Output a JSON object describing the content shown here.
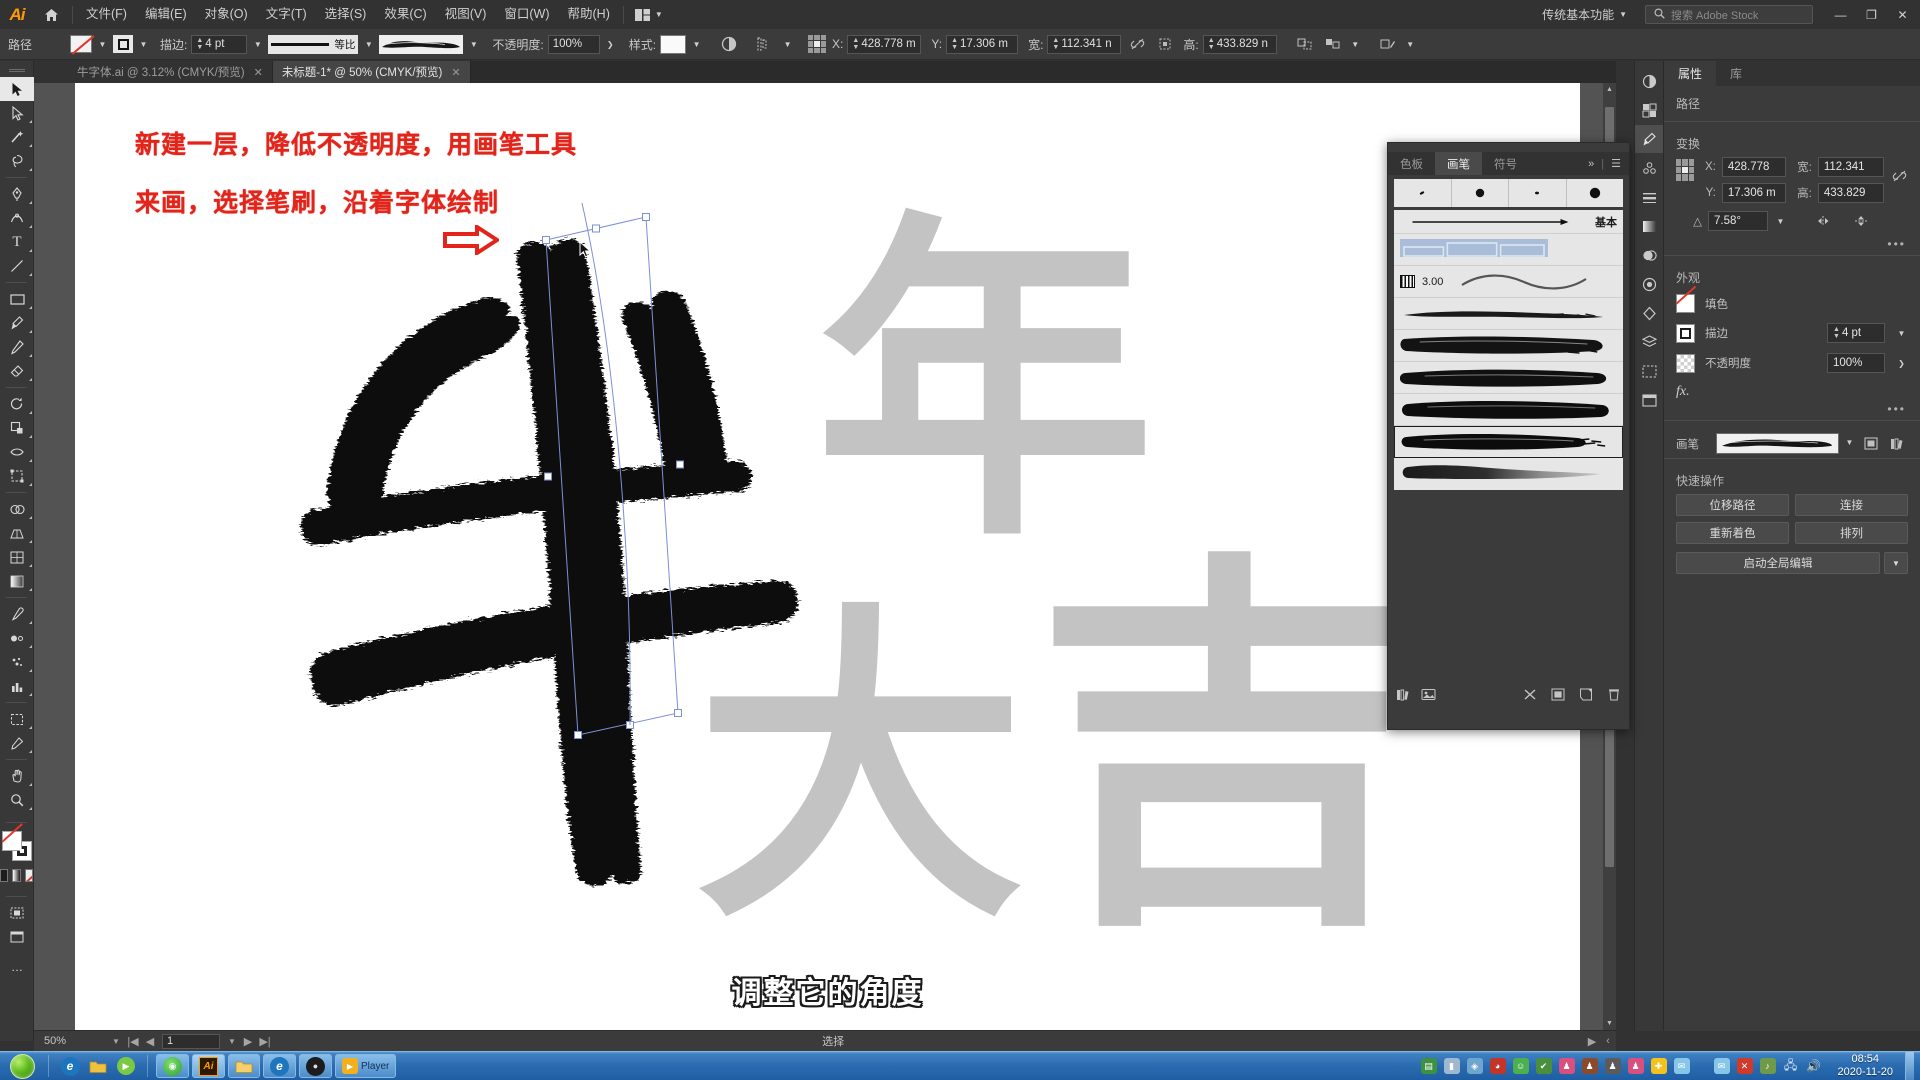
{
  "app": {
    "logo": "Ai",
    "home_icon": "home-icon",
    "workspace": "传统基本功能",
    "search_placeholder": "搜索 Adobe Stock",
    "search_icon": "search-icon",
    "window_controls": {
      "minimize": "—",
      "maximize": "❐",
      "close": "✕"
    }
  },
  "menu": {
    "items": [
      {
        "label": "文件(F)"
      },
      {
        "label": "编辑(E)"
      },
      {
        "label": "对象(O)"
      },
      {
        "label": "文字(T)"
      },
      {
        "label": "选择(S)"
      },
      {
        "label": "效果(C)"
      },
      {
        "label": "视图(V)"
      },
      {
        "label": "窗口(W)"
      },
      {
        "label": "帮助(H)"
      }
    ],
    "arrange_icon": "arrange-documents-icon"
  },
  "control_bar": {
    "object_label": "路径",
    "fill_swatch": "none-fill-swatch",
    "stroke_swatch": "black-stroke-swatch",
    "stroke_label": "描边:",
    "stroke_weight": "4 pt",
    "stroke_profile": "等比",
    "brush_definition": "brush-stroke-preview",
    "opacity_label": "不透明度:",
    "opacity_value": "100%",
    "style_label": "样式:",
    "style_swatch": "white-style-swatch",
    "isolate_icon": "isolate-icon",
    "align_icon": "align-icon",
    "transform_reference_icon": "reference-point-icon",
    "x_label": "X:",
    "x_value": "428.778 m",
    "y_label": "Y:",
    "y_value": "17.306 m",
    "w_label": "宽:",
    "w_value": "112.341 n",
    "h_label": "高:",
    "h_value": "433.829 n",
    "lock_ratio_icon": "unlinked-chain-icon",
    "flip_icon": "flip-icon",
    "transform_more_icon": "transform-icon",
    "select_similar_icon": "select-similar-icon",
    "recolor_icon": "recolor-artwork-icon"
  },
  "tabs": [
    {
      "title": "牛字体.ai @ 3.12% (CMYK/预览)",
      "active": false,
      "close_icon": "close-icon"
    },
    {
      "title": "未标题-1* @ 50% (CMYK/预览)",
      "active": true,
      "close_icon": "close-icon"
    }
  ],
  "toolbar": {
    "tools": [
      {
        "name": "selection-tool",
        "glyph": "➤",
        "active": true
      },
      {
        "name": "direct-selection-tool",
        "glyph": "➣",
        "active": false
      },
      {
        "name": "magic-wand-tool",
        "glyph": "✧",
        "active": false
      },
      {
        "name": "lasso-tool",
        "glyph": "◠",
        "active": false
      },
      {
        "name": "pen-tool",
        "glyph": "✒",
        "active": false
      },
      {
        "name": "curvature-tool",
        "glyph": "⌒",
        "active": false
      },
      {
        "name": "type-tool",
        "glyph": "T",
        "active": false
      },
      {
        "name": "line-segment-tool",
        "glyph": "╱",
        "active": false
      },
      {
        "name": "rectangle-tool",
        "glyph": "▭",
        "active": false
      },
      {
        "name": "paintbrush-tool",
        "glyph": "🖌",
        "active": false
      },
      {
        "name": "shaper-tool",
        "glyph": "✎",
        "active": false
      },
      {
        "name": "eraser-tool",
        "glyph": "◧",
        "active": false
      },
      {
        "name": "rotate-tool",
        "glyph": "↻",
        "active": false
      },
      {
        "name": "scale-tool",
        "glyph": "⤢",
        "active": false
      },
      {
        "name": "width-tool",
        "glyph": "⌁",
        "active": false
      },
      {
        "name": "free-transform-tool",
        "glyph": "⬚",
        "active": false
      },
      {
        "name": "shape-builder-tool",
        "glyph": "◉",
        "active": false
      },
      {
        "name": "perspective-grid-tool",
        "glyph": "⧉",
        "active": false
      },
      {
        "name": "mesh-tool",
        "glyph": "▦",
        "active": false
      },
      {
        "name": "gradient-tool",
        "glyph": "▥",
        "active": false
      },
      {
        "name": "eyedropper-tool",
        "glyph": "⚲",
        "active": false
      },
      {
        "name": "blend-tool",
        "glyph": "⬗",
        "active": false
      },
      {
        "name": "symbol-sprayer-tool",
        "glyph": "❀",
        "active": false
      },
      {
        "name": "column-graph-tool",
        "glyph": "📊",
        "active": false
      },
      {
        "name": "artboard-tool",
        "glyph": "⊞",
        "active": false
      },
      {
        "name": "slice-tool",
        "glyph": "✂",
        "active": false
      },
      {
        "name": "hand-tool",
        "glyph": "✋",
        "active": false
      },
      {
        "name": "zoom-tool",
        "glyph": "🔍",
        "active": false
      }
    ],
    "fill_stroke": {
      "fill": "none-fill",
      "stroke": "black-stroke"
    },
    "color_modes": [
      "color-mode",
      "gradient-mode",
      "none-mode"
    ],
    "more_tools": "…"
  },
  "canvas": {
    "background_characters": [
      "年",
      "大",
      "吉"
    ],
    "annotations": [
      {
        "text": "新建一层，降低不透明度，用画笔工具",
        "color": "#e1251b"
      },
      {
        "text": "来画，选择笔刷，沿着字体绘制",
        "color": "#e1251b"
      }
    ],
    "arrow_icon": "right-arrow-icon",
    "subtitle": "调整它的角度"
  },
  "status_bar": {
    "zoom": "50%",
    "page_number": "1",
    "tool_status": "选择",
    "first_icon": "first-page-icon",
    "prev_icon": "prev-page-icon",
    "next_icon": "next-page-icon",
    "last_icon": "last-page-icon"
  },
  "dock_rail": {
    "buttons": [
      {
        "name": "color-panel-icon",
        "glyph": "◑"
      },
      {
        "name": "swatches-panel-icon",
        "glyph": "▤"
      },
      {
        "name": "brushes-panel-icon",
        "glyph": "❙",
        "active": true
      },
      {
        "name": "symbols-panel-icon",
        "glyph": "✿"
      },
      {
        "name": "stroke-panel-icon",
        "glyph": "☰"
      },
      {
        "name": "gradient-panel-icon",
        "glyph": "▨"
      },
      {
        "name": "transparency-panel-icon",
        "glyph": "◍"
      },
      {
        "name": "appearance-panel-icon",
        "glyph": "◎"
      },
      {
        "name": "graphic-styles-panel-icon",
        "glyph": "◈"
      },
      {
        "name": "layers-panel-icon",
        "glyph": "❏"
      },
      {
        "name": "artboards-panel-icon",
        "glyph": "⊡"
      },
      {
        "name": "libraries-panel-icon",
        "glyph": "▣"
      }
    ]
  },
  "properties": {
    "tabs": [
      {
        "label": "属性",
        "active": true
      },
      {
        "label": "库",
        "active": false
      }
    ],
    "object_type": "路径",
    "transform": {
      "title": "变换",
      "reference_point_icon": "reference-point-icon",
      "x_label": "X:",
      "x_value": "428.778",
      "y_label": "Y:",
      "y_value": "17.306 m",
      "w_label": "宽:",
      "w_value": "112.341",
      "h_label": "高:",
      "h_value": "433.829",
      "angle_label": "△",
      "angle_value": "7.58°",
      "link_icon": "unlinked-chain-icon",
      "flip_h_icon": "flip-horizontal-icon",
      "flip_v_icon": "flip-vertical-icon",
      "more_icon": "more-options-icon"
    },
    "appearance": {
      "title": "外观",
      "fill_label": "填色",
      "stroke_label": "描边",
      "stroke_value": "4 pt",
      "opacity_label": "不透明度",
      "opacity_value": "100%",
      "fx_label": "fx.",
      "more_icon": "more-options-icon"
    },
    "brush": {
      "label": "画笔",
      "preview": "charcoal-brush-preview",
      "options_icon": "brush-options-icon",
      "libraries_icon": "brush-libraries-icon"
    },
    "quick_actions": {
      "title": "快速操作",
      "buttons": [
        "位移路径",
        "连接",
        "重新着色",
        "排列"
      ],
      "global_edit": "启动全局编辑",
      "global_edit_chevron": "chevron-down-icon"
    }
  },
  "brushes_panel": {
    "tabs": [
      {
        "label": "色板",
        "active": false
      },
      {
        "label": "画笔",
        "active": true
      },
      {
        "label": "符号",
        "active": false
      }
    ],
    "collapse_icon": "collapse-icon",
    "menu_icon": "panel-menu-icon",
    "filter_cells": [
      "calligraphic-brush-filter",
      "scatter-brush-filter",
      "art-brush-filter",
      "bristle-brush-filter"
    ],
    "items": [
      {
        "label": "基本",
        "type": "basic-stroke",
        "selected": false
      },
      {
        "label": "",
        "type": "pattern-brush",
        "selected": false
      },
      {
        "label": "3.00",
        "type": "calligraphic-brush",
        "selected": false
      },
      {
        "label": "",
        "type": "charcoal-thin",
        "selected": false
      },
      {
        "label": "",
        "type": "charcoal-rough",
        "selected": false
      },
      {
        "label": "",
        "type": "dry-ink",
        "selected": false
      },
      {
        "label": "",
        "type": "dry-brush",
        "selected": false
      },
      {
        "label": "",
        "type": "charcoal-selected",
        "selected": true
      },
      {
        "label": "",
        "type": "tapered-ink",
        "selected": false
      }
    ],
    "footer_icons": [
      "brush-libraries-icon",
      "libraries-panel-icon",
      "remove-brush-link-icon",
      "options-of-selected-object-icon",
      "new-brush-icon",
      "delete-brush-icon"
    ]
  },
  "taskbar": {
    "start": "start-orb",
    "quick_launch": [
      {
        "name": "ie-icon",
        "glyph": "e",
        "color": "#1d75bd"
      },
      {
        "name": "folder-icon",
        "glyph": "📁",
        "color": "#f0c040"
      },
      {
        "name": "media-icon",
        "glyph": "▶",
        "color": "#7ac943"
      }
    ],
    "tasks": [
      {
        "name": "taskbar-item-chrome",
        "glyph": "◉",
        "color": "#3cb54a",
        "active": false
      },
      {
        "name": "taskbar-item-illustrator",
        "glyph": "Ai",
        "color": "#ff9a00",
        "active": true
      },
      {
        "name": "taskbar-item-explorer",
        "glyph": "📁",
        "color": "#f5d06a",
        "active": false
      },
      {
        "name": "taskbar-item-browser",
        "glyph": "e",
        "color": "#7ac943",
        "active": false
      },
      {
        "name": "taskbar-item-app",
        "glyph": "●",
        "color": "#222222",
        "active": false
      },
      {
        "name": "taskbar-item-player",
        "glyph": "Player",
        "color": "#f2b01e",
        "active": false
      }
    ],
    "tray": [
      {
        "name": "usb-icon",
        "color": "#3f9142"
      },
      {
        "name": "thermometer-icon",
        "color": "#9fb8cf"
      },
      {
        "name": "shield-icon",
        "color": "#6fa5cf"
      },
      {
        "name": "qq-doctor-icon",
        "color": "#c2352b"
      },
      {
        "name": "green-badge-icon",
        "color": "#4caf50"
      },
      {
        "name": "antivirus-icon",
        "color": "#4a8f3c"
      },
      {
        "name": "qq-penguin-icon",
        "color": "#d94f7e"
      },
      {
        "name": "qq-penguin-2-icon",
        "color": "#8a4a2b"
      },
      {
        "name": "qq-penguin-3-icon",
        "color": "#5b5b5b"
      },
      {
        "name": "qq-penguin-4-icon",
        "color": "#d94f7e"
      },
      {
        "name": "plus-icon",
        "color": "#f2c31e"
      },
      {
        "name": "chat-icon",
        "color": "#87c6e8"
      },
      {
        "name": "chat-2-icon",
        "color": "#87c6e8"
      },
      {
        "name": "error-icon",
        "color": "#d03a2b"
      },
      {
        "name": "mute-icon",
        "color": "#6f9a4a"
      },
      {
        "name": "network-icon",
        "color": "#c9d6e4"
      },
      {
        "name": "volume-icon",
        "color": "#ffffff"
      }
    ],
    "clock_time": "08:54",
    "clock_date": "2020-11-20"
  }
}
